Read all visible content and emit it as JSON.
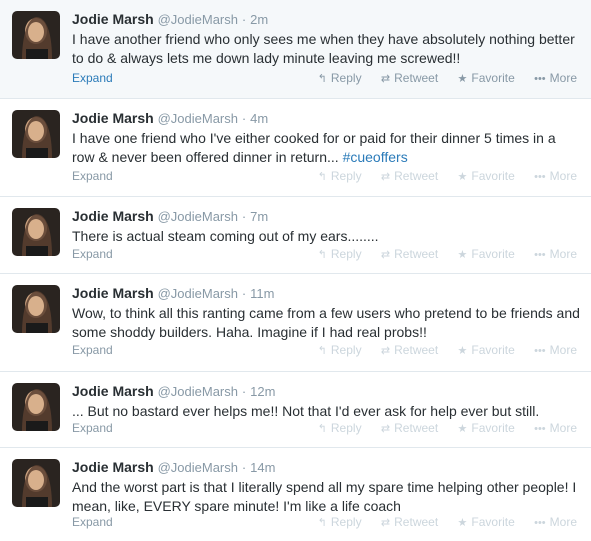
{
  "tweets": [
    {
      "name": "Jodie Marsh",
      "handle": "@JodieMarsh",
      "time": "2m",
      "text_before": "I have another friend who only sees me when they have absolutely nothing better to do & always lets me down lady minute leaving me screwed!!",
      "hashtag": "",
      "expand": "Expand",
      "reply": "Reply",
      "retweet": "Retweet",
      "favorite": "Favorite",
      "more": "More"
    },
    {
      "name": "Jodie Marsh",
      "handle": "@JodieMarsh",
      "time": "4m",
      "text_before": "I have one friend who I've either cooked for or paid for their dinner 5 times in a row & never been offered dinner in return... ",
      "hashtag": "#cueoffers",
      "expand": "Expand",
      "reply": "Reply",
      "retweet": "Retweet",
      "favorite": "Favorite",
      "more": "More"
    },
    {
      "name": "Jodie Marsh",
      "handle": "@JodieMarsh",
      "time": "7m",
      "text_before": "There is actual steam coming out of my ears........",
      "hashtag": "",
      "expand": "Expand",
      "reply": "Reply",
      "retweet": "Retweet",
      "favorite": "Favorite",
      "more": "More"
    },
    {
      "name": "Jodie Marsh",
      "handle": "@JodieMarsh",
      "time": "11m",
      "text_before": "Wow, to think all this ranting came from a few users who pretend to be friends and some shoddy builders. Haha. Imagine if I had real probs!!",
      "hashtag": "",
      "expand": "Expand",
      "reply": "Reply",
      "retweet": "Retweet",
      "favorite": "Favorite",
      "more": "More"
    },
    {
      "name": "Jodie Marsh",
      "handle": "@JodieMarsh",
      "time": "12m",
      "text_before": "... But no bastard ever helps me!! Not that I'd ever ask for help ever but still.",
      "hashtag": "",
      "expand": "Expand",
      "reply": "Reply",
      "retweet": "Retweet",
      "favorite": "Favorite",
      "more": "More"
    },
    {
      "name": "Jodie Marsh",
      "handle": "@JodieMarsh",
      "time": "14m",
      "text_before": "And the worst part is that I literally spend all my spare time helping other people! I mean, like, EVERY spare minute! I'm like a life coach",
      "hashtag": "",
      "expand": "Expand",
      "reply": "Reply",
      "retweet": "Retweet",
      "favorite": "Favorite",
      "more": "More"
    }
  ],
  "icons": {
    "reply": "reply-arrow-icon",
    "retweet": "retweet-icon",
    "favorite": "star-icon",
    "more": "more-dots-icon"
  },
  "colors": {
    "link": "#2b7bb9",
    "muted": "#8899a6",
    "faded": "#ccd6dd",
    "text": "#292f33",
    "divider": "#e1e8ed"
  }
}
